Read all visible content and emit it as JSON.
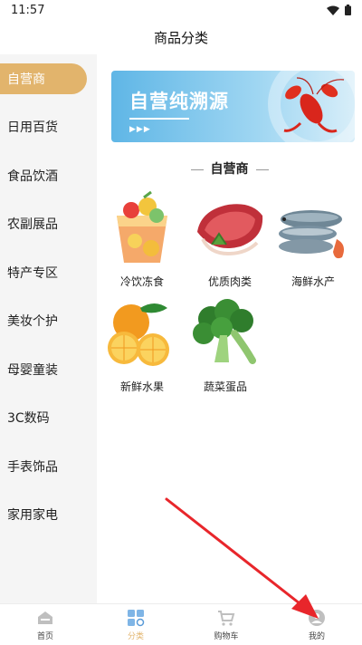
{
  "status_bar": {
    "time": "11:57"
  },
  "header": {
    "title": "商品分类"
  },
  "sidebar": {
    "items": [
      {
        "label": "自营商",
        "active": true
      },
      {
        "label": "日用百货"
      },
      {
        "label": "食品饮酒"
      },
      {
        "label": "农副展品"
      },
      {
        "label": "特产专区"
      },
      {
        "label": "美妆个护"
      },
      {
        "label": "母婴童装"
      },
      {
        "label": "3C数码"
      },
      {
        "label": "手表饰品"
      },
      {
        "label": "家用家电"
      }
    ]
  },
  "banner": {
    "text": "自营纯溯源",
    "arrows": "▶▶▶"
  },
  "section": {
    "title": "自营商"
  },
  "categories": [
    {
      "name": "冷饮冻食",
      "icon": "cold-drink-icon"
    },
    {
      "name": "优质肉类",
      "icon": "meat-icon"
    },
    {
      "name": "海鲜水产",
      "icon": "seafood-icon"
    },
    {
      "name": "新鲜水果",
      "icon": "fruit-icon"
    },
    {
      "name": "蔬菜蛋品",
      "icon": "vegetable-icon"
    }
  ],
  "tabbar": {
    "items": [
      {
        "label": "首页",
        "icon": "home-icon"
      },
      {
        "label": "分类",
        "icon": "category-icon",
        "active": true
      },
      {
        "label": "购物车",
        "icon": "cart-icon"
      },
      {
        "label": "我的",
        "icon": "profile-icon"
      }
    ]
  },
  "colors": {
    "accent": "#e2b46c",
    "annotation": "#e8262b",
    "banner": "#5fb6e6"
  }
}
